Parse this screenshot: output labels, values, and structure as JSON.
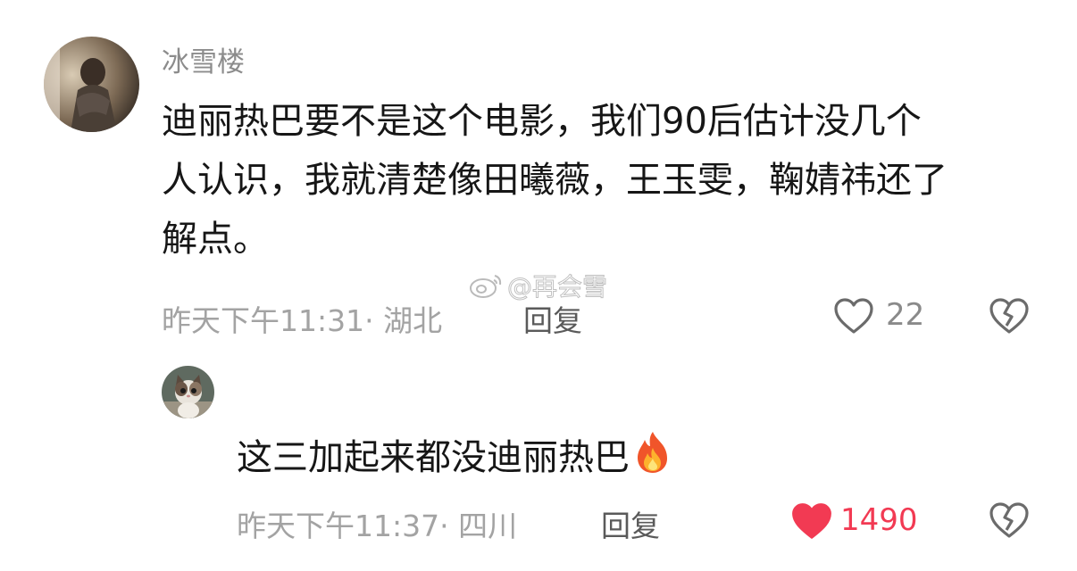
{
  "watermark": {
    "text": "@再会雪"
  },
  "main_comment": {
    "username": "冰雪楼",
    "text_lines": [
      "迪丽热巴要不是这个电影，我们90后估计没几个",
      "人认识，我就清楚像田曦薇，王玉雯，鞠婧祎还了",
      "解点。"
    ],
    "timestamp": "昨天下午11:31",
    "location": "湖北",
    "reply_label": "回复",
    "like_count": "22",
    "liked": false
  },
  "reply_comment": {
    "text": "这三加起来都没迪丽热巴",
    "emoji": "fire",
    "timestamp": "昨天下午11:37",
    "location": "四川",
    "reply_label": "回复",
    "like_count": "1490",
    "liked": true
  },
  "colors": {
    "liked": "#f23a53",
    "muted": "#a3a3a3",
    "icon": "#6b6b6b"
  }
}
